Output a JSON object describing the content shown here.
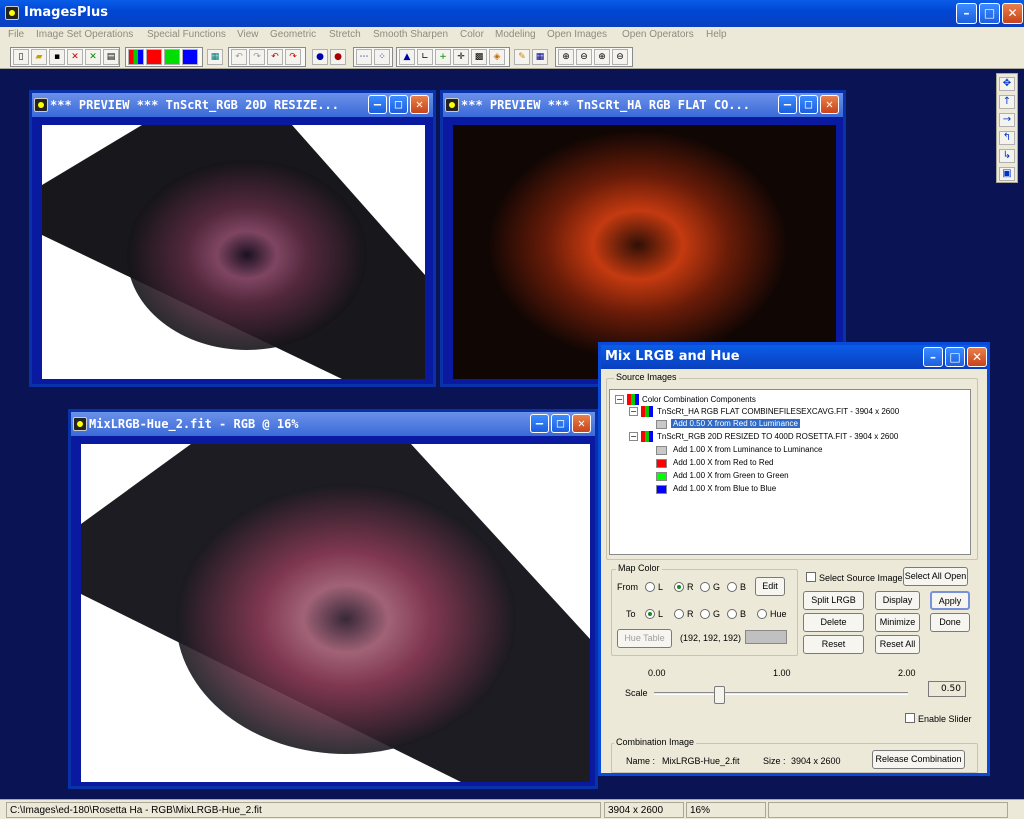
{
  "app": {
    "title": "ImagesPlus"
  },
  "menu": [
    "File",
    "Image Set Operations",
    "Special Functions",
    "View",
    "Geometric",
    "Stretch",
    "Smooth Sharpen",
    "Color",
    "Modeling",
    "Open Images",
    "Open Operators",
    "Help"
  ],
  "windows": {
    "preview1": {
      "title": "*** PREVIEW *** TnScRt_RGB 20D RESIZE..."
    },
    "preview2": {
      "title": "*** PREVIEW *** TnScRt_HA RGB FLAT CO..."
    },
    "main": {
      "title": "MixLRGB-Hue_2.fit - RGB @ 16%"
    }
  },
  "dialog": {
    "title": "Mix LRGB and Hue",
    "source_group": "Source Images",
    "tree": {
      "root": "Color Combination Components",
      "img1": "TnScRt_HA RGB FLAT COMBINEFILESEXCAVG.FIT - 3904 x 2600",
      "img1_items": [
        "Add 0.50 X from Red to Luminance"
      ],
      "img2": "TnScRt_RGB 20D RESIZED TO 400D ROSETTA.FIT - 3904 x 2600",
      "img2_items": [
        "Add 1.00 X from Luminance to Luminance",
        "Add 1.00 X from Red to Red",
        "Add 1.00 X from Green to Green",
        "Add 1.00 X from Blue to Blue"
      ]
    },
    "map_color": {
      "legend": "Map Color",
      "from_label": "From",
      "to_label": "To",
      "opt_L": "L",
      "opt_R": "R",
      "opt_G": "G",
      "opt_B": "B",
      "opt_Hue": "Hue",
      "edit": "Edit",
      "hue_table": "Hue Table",
      "rgb_value": "(192, 192, 192)"
    },
    "select_source": "Select Source Image",
    "buttons": {
      "select_all_open": "Select All Open",
      "split": "Split LRGB",
      "display": "Display",
      "apply": "Apply",
      "delete": "Delete",
      "minimize": "Minimize",
      "done": "Done",
      "reset": "Reset",
      "reset_all": "Reset All",
      "release": "Release Combination"
    },
    "scale": {
      "label": "Scale",
      "min": "0.00",
      "mid": "1.00",
      "max": "2.00",
      "value": "0.50",
      "enable": "Enable Slider"
    },
    "combination": {
      "legend": "Combination Image",
      "name_label": "Name :",
      "name": "MixLRGB-Hue_2.fit",
      "size_label": "Size :",
      "size": "3904 x 2600"
    }
  },
  "status": {
    "path": "C:\\Images\\ed-180\\Rosetta Ha - RGB\\MixLRGB-Hue_2.fit",
    "dims": "3904 x 2600",
    "zoom": "16%"
  },
  "colors": {
    "desktop": "#0a1454",
    "accent": "#0a4ad8",
    "selection": "#316ac5"
  }
}
